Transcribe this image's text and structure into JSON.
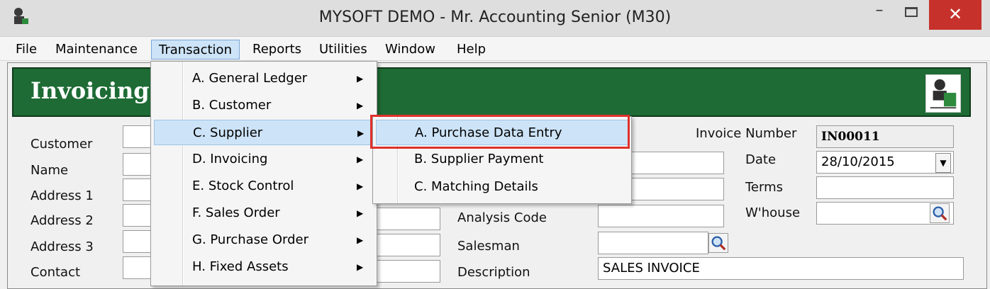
{
  "window": {
    "title": "MYSOFT DEMO - Mr. Accounting Senior (M30)",
    "minimize": "–",
    "close": "✕"
  },
  "menubar": [
    "File",
    "Maintenance",
    "Transaction",
    "Reports",
    "Utilities",
    "Window",
    "Help"
  ],
  "form": {
    "banner_title": "Invoicing",
    "left_labels": [
      "Customer",
      "Name",
      "Address 1",
      "Address 2",
      "Address 3",
      "Contact"
    ],
    "mid_labels": {
      "analysis_code": "Analysis Code",
      "salesman": "Salesman",
      "description": "Description"
    },
    "description_value": "SALES INVOICE",
    "invoice_number_label": "Invoice Number",
    "invoice_number_value": "IN00011",
    "date_label": "Date",
    "date_value": "28/10/2015",
    "terms_label": "Terms",
    "whouse_label": "W'house"
  },
  "transaction_menu": [
    "A. General Ledger",
    "B. Customer",
    "C. Supplier",
    "D. Invoicing",
    "E. Stock Control",
    "F. Sales Order",
    "G. Purchase Order",
    "H. Fixed Assets"
  ],
  "supplier_submenu": [
    "A. Purchase Data Entry",
    "B. Supplier Payment",
    "C. Matching Details"
  ],
  "icons": {
    "arrow": "▶",
    "dropdown": "▼"
  },
  "colors": {
    "banner": "#1e6b35",
    "highlight_box": "#e0312b",
    "menu_highlight": "#cde3f7"
  }
}
